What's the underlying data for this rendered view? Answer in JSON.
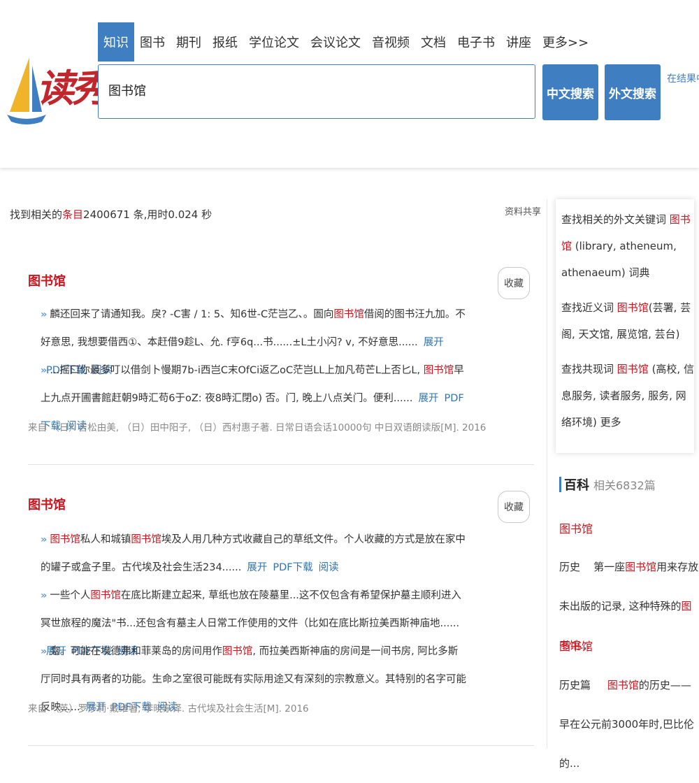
{
  "brand": {
    "logo_text": "读秀",
    "colors": {
      "accent": "#3f7fc1",
      "highlight": "#d4121c",
      "logo_red": "#c0262c",
      "logo_sail_yellow": "#f0b429"
    }
  },
  "tabs": [
    "知识",
    "图书",
    "期刊",
    "报纸",
    "学位论文",
    "会议论文",
    "音视频",
    "文档",
    "电子书",
    "讲座",
    "更多>>"
  ],
  "search": {
    "value": "图书馆",
    "btn_chinese": "中文搜索",
    "btn_foreign": "外文搜索",
    "in_result": "在结果中搜索"
  },
  "summary": {
    "prefix": "找到相关的",
    "keyword": "条目",
    "count": "2400671",
    "suffix": " 条,用时0.024 秒"
  },
  "share": "资料共享",
  "results": [
    {
      "title": "图书馆",
      "collect": "收藏",
      "snippet1_a": "麟还回来了请通知我。戾? -C害 / 1: 5、知6世-C茫岂乙、。圄向",
      "snippet1_hl": "图书馆",
      "snippet1_b": "借阅的图书汪九加。不好意思, 我想要借西①、本赶借9趁L、允. f亨6q...书......±L土小闪? v, 不好意思......",
      "snippet2_a": "...摇口你最多叮以借剑卜慢期7b-i西岂C末OfCi返乙oC茫岂LL上加凡苟芒L上否匕L, ",
      "snippet2_hl": "图书馆",
      "snippet2_b": "早上九点开圃書館赶朝9時汇苟6于oZ: 夜8時汇閉o) 否。门, 晚上八点关门。便利......",
      "link_expand": "展开",
      "link_pdf": "PDF下载",
      "link_read": "阅读",
      "source": "来自 （日）吉松由美, （日）田中阳子, （日）西村惠子著. 日常日语会话10000句 中日双语朗读版[M]. 2016"
    },
    {
      "title": "图书馆",
      "collect": "收藏",
      "snippet1_hl1": "图书馆",
      "snippet1_a": "私人和城镇",
      "snippet1_hl2": "图书馆",
      "snippet1_b": "埃及人用几种方式收藏自己的草纸文件。个人收藏的方式是放在家中的罐子或盒子里。古代埃及社会生活234......",
      "snippet2_a": "一些个人",
      "snippet2_hl": "图书馆",
      "snippet2_b": "在底比斯建立起来, 草纸也放在陵墓里...这不仅包含有希望保护墓主顺利进入冥世旅程的魔法\"书...还包含有墓主人日常工作使用的文件（比如在底比斯拉美西斯神庙地......",
      "snippet3_a": "龛。可能在埃德弗和菲莱岛的房间用作",
      "snippet3_hl": "图书馆",
      "snippet3_b": ", 而拉美西斯神庙的房间是一间书房, 阿比多斯厅同时具有两者的功能。生命之室很可能既有实际用途又有深刻的宗教意义。其特别的名字可能反映......",
      "link_expand": "展开",
      "link_pdf": "PDF下载",
      "link_read": "阅读",
      "source": "来自 （英）罗莎莉·戴维著; 李晓东译. 古代埃及社会生活[M]. 2016"
    }
  ],
  "related": {
    "foreign_a": "查找相关的外文关键词 ",
    "foreign_hl": "图书馆",
    "foreign_b": " (library, atheneum, athenaeum) 词典",
    "synonym_a": "查找近义词 ",
    "synonym_hl": "图书馆",
    "synonym_b": "(芸署, 芸阁, 天文馆, 展览馆, 芸台)",
    "cooccur_a": "查找共现词 ",
    "cooccur_hl": "图书馆",
    "cooccur_b": " (高校, 信息服务, 读者服务, 服务, 网络环境) 更多"
  },
  "baike": {
    "heading": "百科",
    "count": "相关6832篇",
    "items": [
      {
        "title": "图书馆",
        "label": "历史",
        "a": "第一座",
        "hl1": "图书馆",
        "b": "用来存放未出版的记录, 这种特殊的",
        "hl2": "图书馆",
        "c": "..."
      },
      {
        "title": "图书馆",
        "label": "历史篇",
        "hl1": "图书馆",
        "b": "的历史——早在公元前3000年时,巴比伦的..."
      }
    ]
  }
}
